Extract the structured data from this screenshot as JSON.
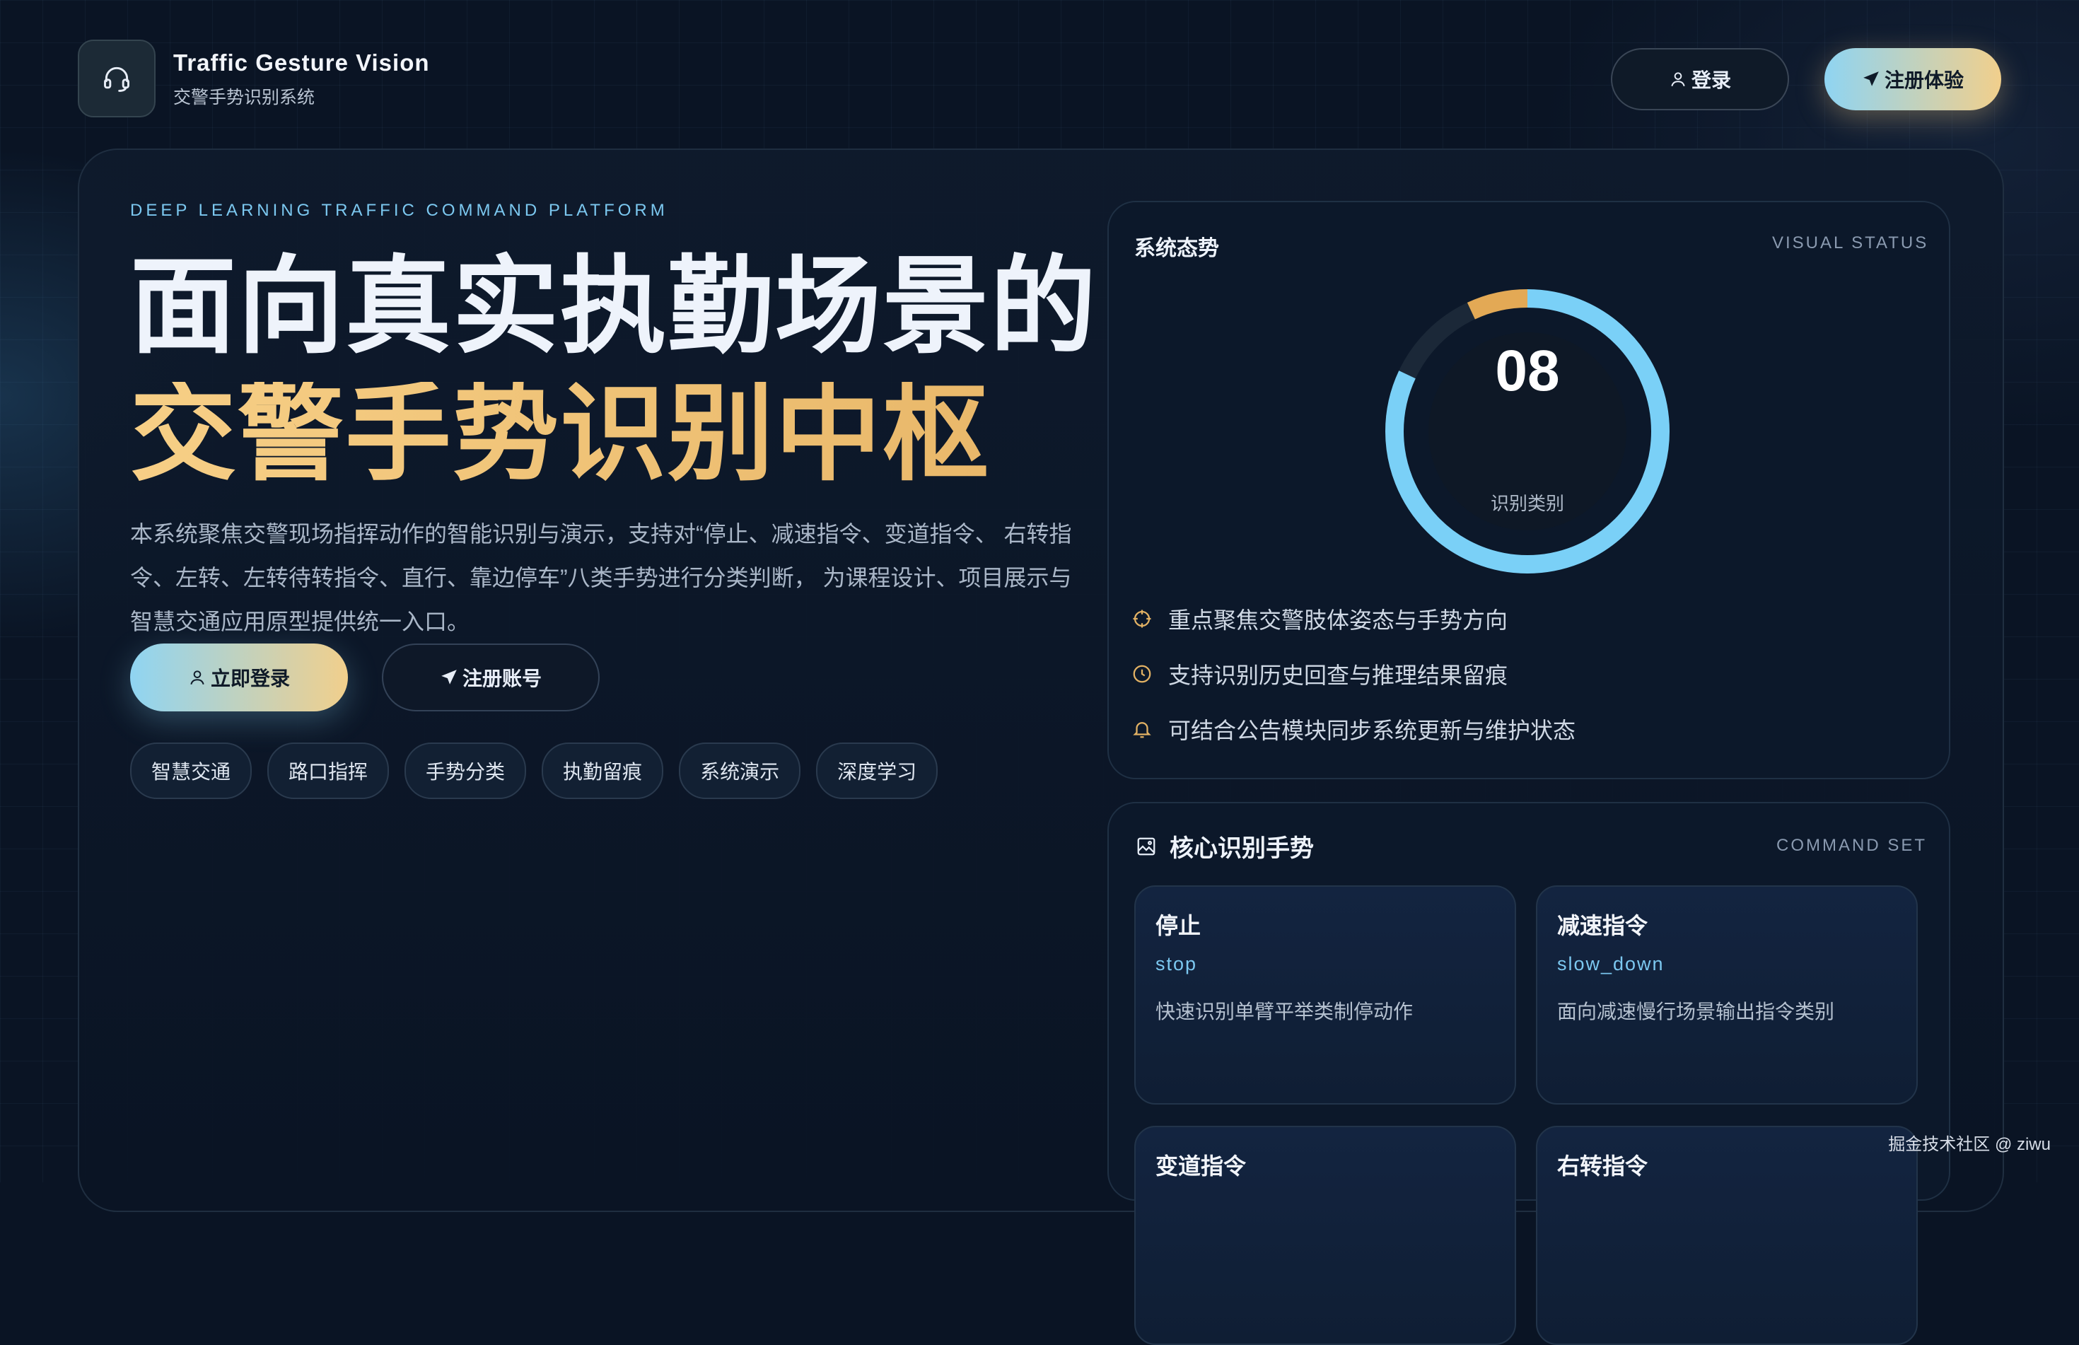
{
  "header": {
    "brand_title": "Traffic Gesture Vision",
    "brand_subtitle": "交警手势识别系统",
    "login_label": "登录",
    "register_label": "注册体验"
  },
  "hero": {
    "eyebrow": "DEEP LEARNING TRAFFIC COMMAND PLATFORM",
    "title_line1": "面向真实执勤场景的",
    "title_line2": "交警手势识别中枢",
    "description": "本系统聚焦交警现场指挥动作的智能识别与演示，支持对“停止、减速指令、变道指令、 右转指令、左转、左转待转指令、直行、靠边停车”八类手势进行分类判断， 为课程设计、项目展示与智慧交通应用原型提供统一入口。",
    "cta_primary": "立即登录",
    "cta_secondary": "注册账号",
    "tags": [
      "智慧交通",
      "路口指挥",
      "手势分类",
      "执勤留痕",
      "系统演示",
      "深度学习"
    ]
  },
  "status_card": {
    "title": "系统态势",
    "tag": "VISUAL STATUS",
    "gauge_value": "08",
    "gauge_label": "识别类别",
    "gauge_fraction_blue": 0.82,
    "gauge_fraction_gold": 0.18,
    "features": [
      {
        "icon": "crosshair-icon",
        "text": "重点聚焦交警肢体姿态与手势方向"
      },
      {
        "icon": "clock-icon",
        "text": "支持识别历史回查与推理结果留痕"
      },
      {
        "icon": "bell-icon",
        "text": "可结合公告模块同步系统更新与维护状态"
      }
    ]
  },
  "gesture_card": {
    "title": "核心识别手势",
    "tag": "COMMAND SET",
    "items": [
      {
        "name": "停止",
        "code": "stop",
        "desc": "快速识别单臂平举类制停动作"
      },
      {
        "name": "减速指令",
        "code": "slow_down",
        "desc": "面向减速慢行场景输出指令类别"
      },
      {
        "name": "变道指令",
        "code": "",
        "desc": ""
      },
      {
        "name": "右转指令",
        "code": "",
        "desc": ""
      }
    ]
  },
  "watermark": "掘金技术社区 @ ziwu",
  "colors": {
    "background": "#0a1424",
    "accent_blue": "#7cc8f0",
    "accent_gold": "#f1cf8c",
    "gauge_blue": "#7ad0f7",
    "gauge_gold": "#e3a955"
  }
}
